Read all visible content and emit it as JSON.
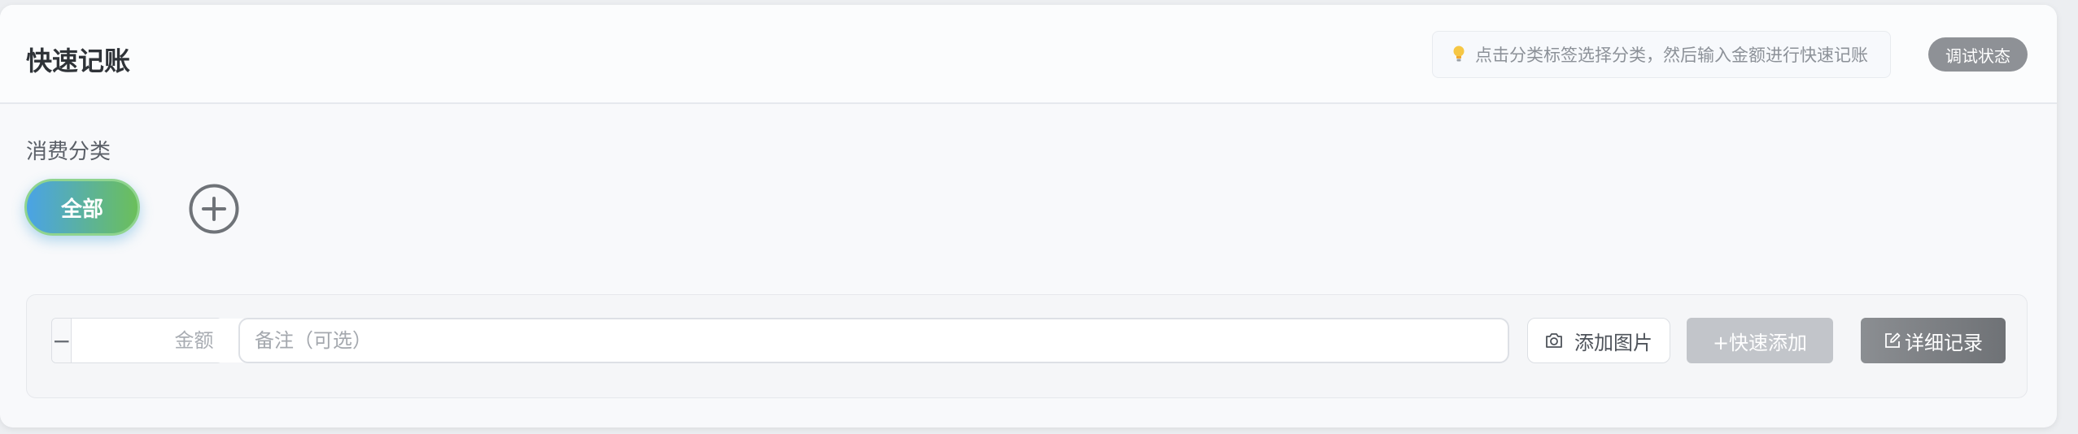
{
  "header": {
    "title": "快速记账",
    "tip": "点击分类标签选择分类，然后输入金额进行快速记账",
    "debug_label": "调试状态"
  },
  "categories": {
    "label": "消费分类",
    "items": [
      {
        "label": "全部",
        "selected": true
      }
    ]
  },
  "entry": {
    "amount_placeholder": "金额",
    "minus_symbol": "−",
    "plus_symbol": "+",
    "note_placeholder": "备注（可选）",
    "add_image_label": "添加图片",
    "quick_add_label": "+快速添加",
    "detail_label": "详细记录"
  },
  "colors": {
    "pill_gradient_start": "#4aa3e6",
    "pill_gradient_end": "#6bbf5a",
    "debug_button": "#8e9196",
    "quick_add_disabled": "#c2c5ca",
    "detail_button": "#7a7d81"
  },
  "icons": {
    "tip": "lightbulb-icon",
    "add_category": "plus-circle-icon",
    "add_image": "camera-icon",
    "detail": "edit-icon"
  }
}
